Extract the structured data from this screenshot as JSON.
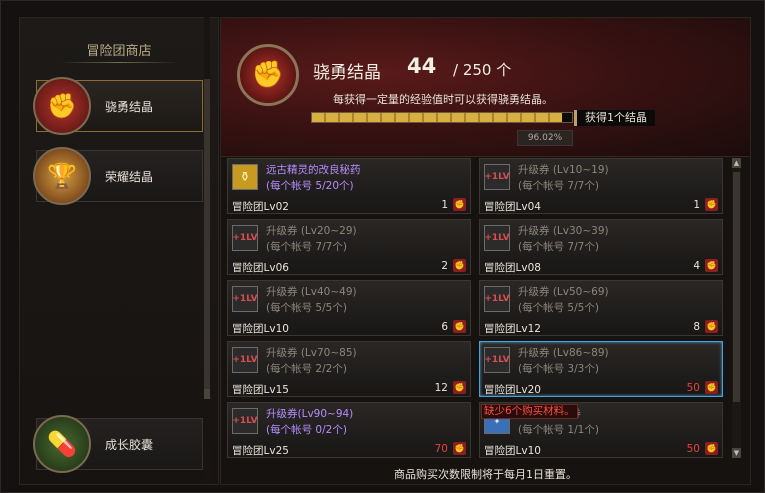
{
  "help_label": "?",
  "sidebar": {
    "title": "冒险团商店",
    "items": [
      {
        "label": "骁勇结晶",
        "icon": "fist-crystal-icon",
        "icon_glyph": "✊"
      },
      {
        "label": "荣耀结晶",
        "icon": "trophy-icon",
        "icon_glyph": "🏆"
      },
      {
        "label": "成长胶囊",
        "icon": "exp-capsule-icon",
        "icon_glyph": "💊"
      }
    ]
  },
  "banner": {
    "name": "骁勇结晶",
    "count": "44",
    "total": "/ 250 个",
    "hint": "每获得一定量的经验值时可以获得骁勇结晶。",
    "progress_fraction": 0.9602,
    "progress_text": "96.02%",
    "tip": "获得1个结晶"
  },
  "items": [
    {
      "name": "远古精灵的改良秘药",
      "limit": "(每个帐号 5/20个)",
      "req": "冒险团Lv02",
      "price": "1",
      "icon": "potion-icon",
      "purple": true,
      "price_red": false
    },
    {
      "name": "升级券 (Lv10~19)",
      "limit": "(每个帐号 7/7个)",
      "req": "冒险团Lv04",
      "price": "1",
      "icon": "level-ticket-icon",
      "purple": false,
      "price_red": false
    },
    {
      "name": "升级券 (Lv20~29)",
      "limit": "(每个帐号 7/7个)",
      "req": "冒险团Lv06",
      "price": "2",
      "icon": "level-ticket-icon",
      "purple": false,
      "price_red": false
    },
    {
      "name": "升级券 (Lv30~39)",
      "limit": "(每个帐号 7/7个)",
      "req": "冒险团Lv08",
      "price": "4",
      "icon": "level-ticket-icon",
      "purple": false,
      "price_red": false
    },
    {
      "name": "升级券 (Lv40~49)",
      "limit": "(每个帐号 5/5个)",
      "req": "冒险团Lv10",
      "price": "6",
      "icon": "level-ticket-icon",
      "purple": false,
      "price_red": false
    },
    {
      "name": "升级券 (Lv50~69)",
      "limit": "(每个帐号 5/5个)",
      "req": "冒险团Lv12",
      "price": "8",
      "icon": "level-ticket-icon",
      "purple": false,
      "price_red": false
    },
    {
      "name": "升级券 (Lv70~85)",
      "limit": "(每个帐号 2/2个)",
      "req": "冒险团Lv15",
      "price": "12",
      "icon": "level-ticket-icon",
      "purple": false,
      "price_red": false
    },
    {
      "name": "升级券 (Lv86~89)",
      "limit": "(每个帐号 3/3个)",
      "req": "冒险团Lv20",
      "price": "50",
      "icon": "level-ticket-icon",
      "purple": false,
      "price_red": true,
      "selected": true
    },
    {
      "name": "升级券(Lv90~94)",
      "limit": "(每个帐号 0/2个)",
      "req": "冒险团Lv25",
      "price": "70",
      "icon": "level-ticket-icon",
      "purple": true,
      "price_red": true
    },
    {
      "name": "觉任务完成券",
      "limit": "(每个帐号 1/1个)",
      "req": "冒险团Lv10",
      "price": "50",
      "icon": "task-ticket-icon",
      "purple": false,
      "price_red": true
    }
  ],
  "warning": "缺少6个购买材料。",
  "footer": "商品购买次数限制将于每月1日重置。",
  "colors": {
    "accent_gold": "#d8b040",
    "price_red": "#e8413a",
    "purple": "#b68cff",
    "selected_border": "#4aa0d8"
  }
}
